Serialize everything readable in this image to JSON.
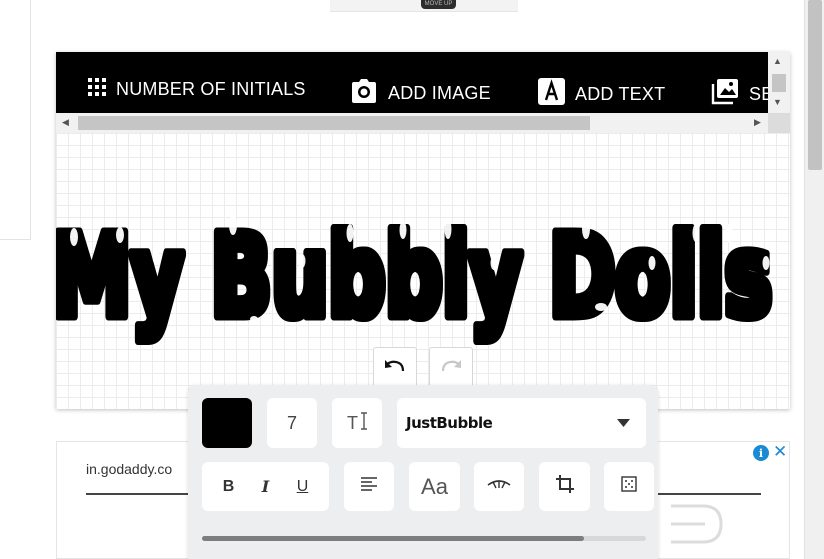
{
  "top_thumb": {
    "label": "MOVE UP"
  },
  "toolbar": {
    "items": [
      {
        "label": "NUMBER OF INITIALS",
        "icon": "grid-icon"
      },
      {
        "label": "ADD IMAGE",
        "icon": "camera-icon"
      },
      {
        "label": "ADD TEXT",
        "icon": "text-a-icon"
      },
      {
        "label": "SE",
        "icon": "image-gallery-icon"
      }
    ]
  },
  "canvas": {
    "text": "My Bubbly Dolls",
    "text_color": "#000000"
  },
  "panel": {
    "color": "#000000",
    "size_value": "7",
    "textsize_label": "T",
    "font_name": "JustBubble",
    "bold_label": "B",
    "italic_label": "I",
    "underline_label": "U",
    "case_label": "Aa",
    "slider_fraction": 0.86
  },
  "ad": {
    "url": "in.godaddy.co",
    "info_label": "i",
    "close_label": "✕"
  }
}
